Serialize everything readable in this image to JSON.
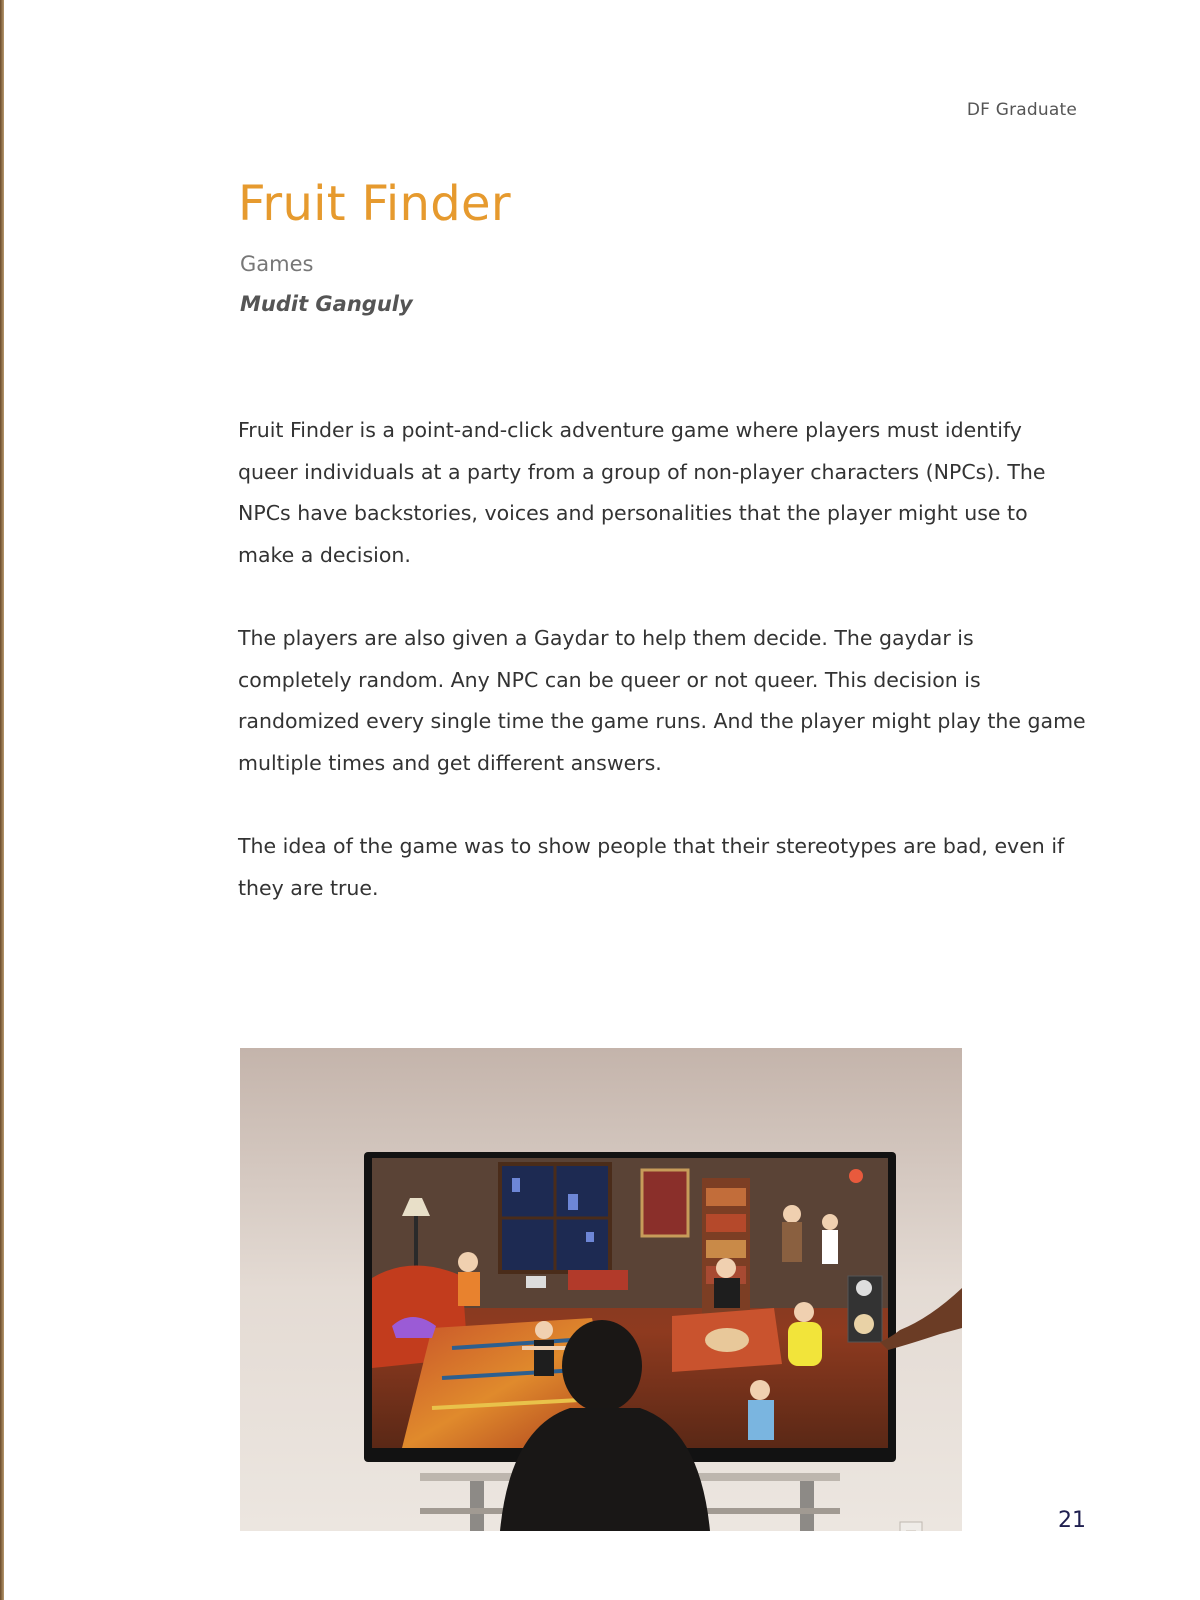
{
  "header": {
    "running_head": "DF Graduate"
  },
  "project": {
    "title": "Fruit Finder",
    "category": "Games",
    "author": "Mudit Ganguly"
  },
  "body": {
    "paragraphs": [
      "Fruit Finder is a point-and-click adventure game where players must identify queer individuals at a party from a group of non-player characters (NPCs). The NPCs have backstories, voices and personalities that the player might use to make a decision.",
      "The players are also given a Gaydar to help them decide. The gaydar is completely random. Any NPC can be queer or not queer. This decision is randomized every single time the game runs. And the player might play the game multiple times and get different answers.",
      "The idea of the game was to show people that their stereotypes are bad, even if they are true."
    ]
  },
  "figure": {
    "icon": "photo-game-installation"
  },
  "footer": {
    "page_number": "21"
  },
  "colors": {
    "title": "#e69a2e",
    "page_number": "#1f1f4f"
  }
}
